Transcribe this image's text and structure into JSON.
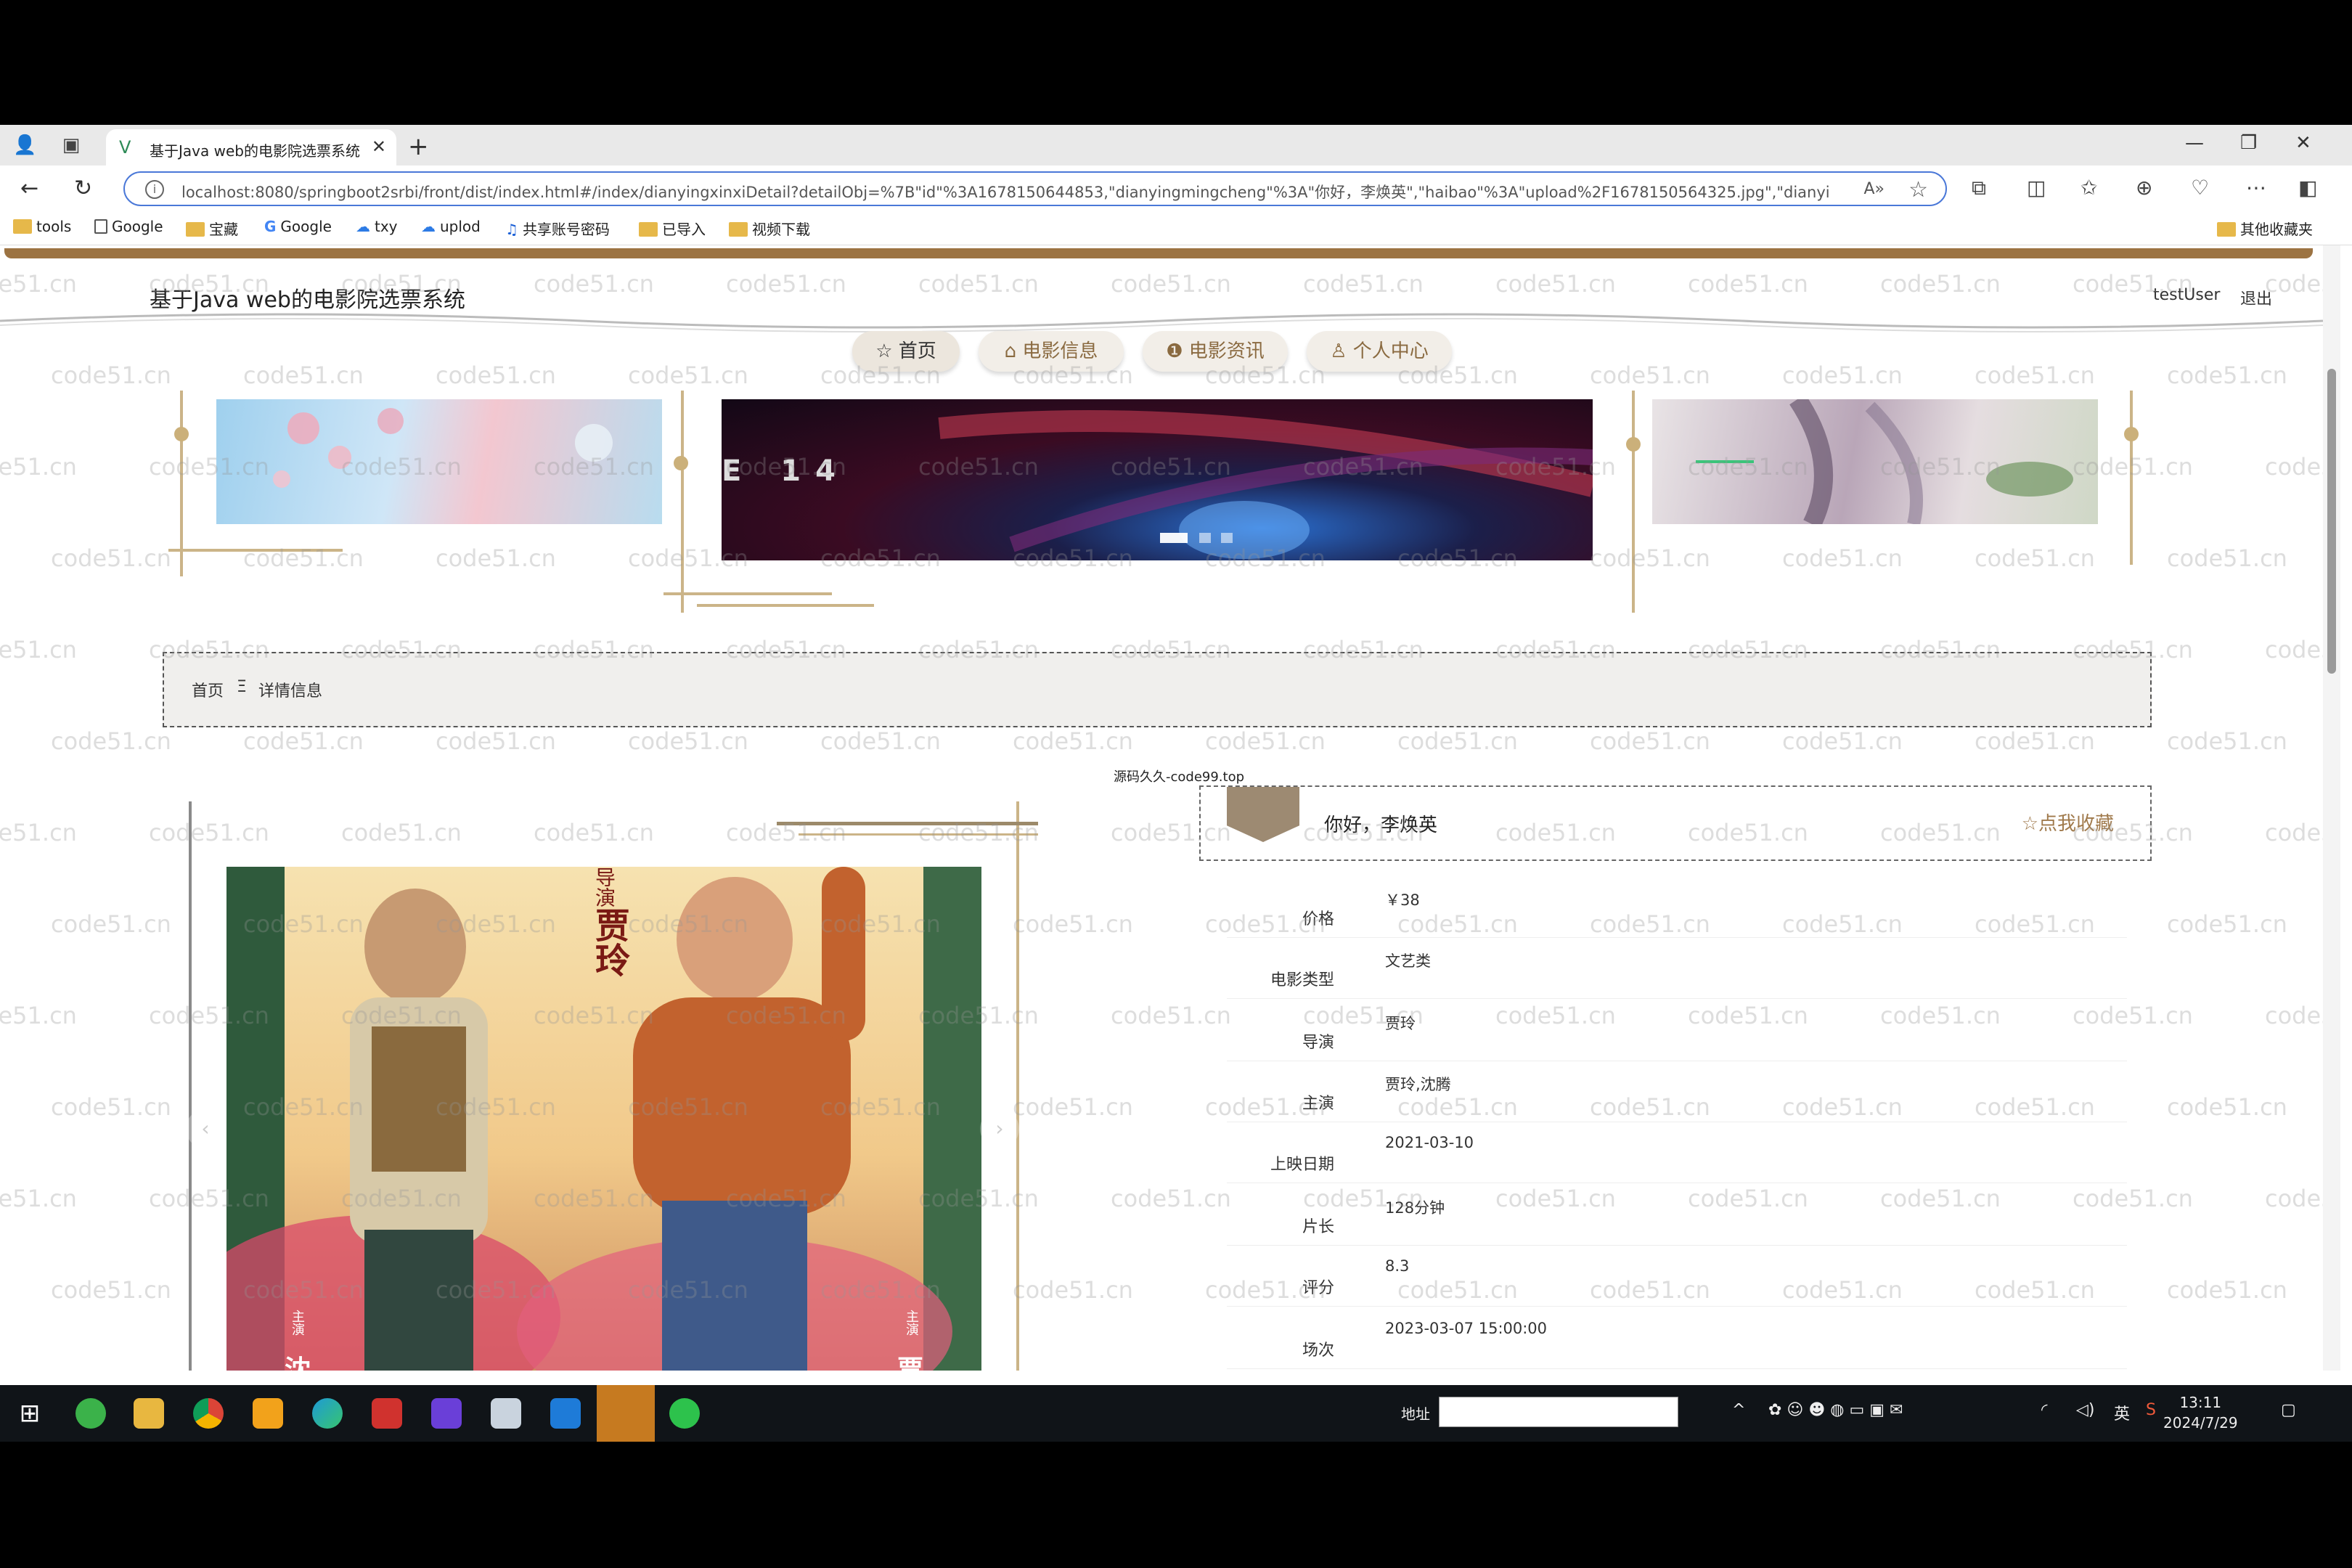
{
  "browser": {
    "tab_title": "基于Java web的电影院选票系统",
    "url": "localhost:8080/springboot2srbi/front/dist/index.html#/index/dianyingxinxiDetail?detailObj=%7B\"id\"%3A1678150644853,\"dianyingmingcheng\"%3A\"你好，李焕英\",\"haibao\"%3A\"upload%2F1678150564325.jpg\",\"dianyingl...",
    "bookmarks": [
      "tools",
      "Google",
      "宝藏",
      "Google",
      "txy",
      "uplod",
      "共享账号密码",
      "已导入",
      "视频下载"
    ],
    "other_bookmarks": "其他收藏夹"
  },
  "site": {
    "title": "基于Java web的电影院选票系统",
    "user": "testUser",
    "logout": "退出",
    "nav": [
      "首页",
      "电影信息",
      "电影资讯",
      "个人中心"
    ]
  },
  "banner": {
    "text": "E 14"
  },
  "breadcrumb": {
    "home": "首页",
    "separator": "Ξ",
    "current": "详情信息"
  },
  "source_note": "源码久久-code99.top",
  "detail": {
    "name": "你好，李焕英",
    "favorite": "☆点我收藏",
    "fields": [
      {
        "label": "价格",
        "value": "￥38"
      },
      {
        "label": "电影类型",
        "value": "文艺类"
      },
      {
        "label": "导演",
        "value": "贾玲"
      },
      {
        "label": "主演",
        "value": "贾玲,沈腾"
      },
      {
        "label": "上映日期",
        "value": "2021-03-10"
      },
      {
        "label": "片长",
        "value": "128分钟"
      },
      {
        "label": "评分",
        "value": "8.3"
      },
      {
        "label": "场次",
        "value": "2023-03-07 15:00:00"
      }
    ]
  },
  "poster": {
    "director_label": "导演",
    "director": "贾玲",
    "lead_left": "沈",
    "lead_right": "贾",
    "lead_label": "主演"
  },
  "watermark": "code51.cn",
  "taskbar": {
    "address_label": "地址",
    "ime": "英",
    "time": "13:11",
    "date": "2024/7/29"
  }
}
